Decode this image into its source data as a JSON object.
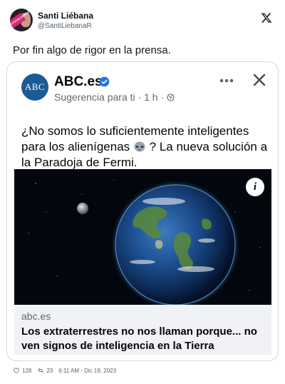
{
  "tweet": {
    "author_name": "Santi Liébana",
    "author_handle": "@SantiLiebanaR",
    "avatar_badge_text": "VISTOENLASREDES",
    "text": "Por fin algo de rigor en la prensa.",
    "likes": "128",
    "retweets": "23",
    "timestamp": "6:11 AM - Dic 19, 2023"
  },
  "embed": {
    "logo_text": "ABC",
    "source_name": "ABC.es",
    "suggestion": "Sugerencia para ti · 1 h ·",
    "headline_before_icon": "¿No somos lo suficientemente inteligentes para los alienígenas",
    "headline_after_icon": "? La nueva solución a la Paradoja de Fermi.",
    "link_domain": "abc.es",
    "link_title": "Los extraterrestres no nos llaman porque... no ven signos de inteligencia en la Tierra",
    "info_label": "i"
  },
  "colors": {
    "abc_blue": "#1c5a95",
    "verified_blue": "#1877f2",
    "link_bg": "#f0f2f5",
    "secondary_text": "#65676b"
  },
  "icons": [
    "x-logo-icon",
    "verified-badge-icon",
    "globe-icon",
    "more-options-icon",
    "close-icon",
    "alien-emoji-icon",
    "info-icon",
    "like-heart-icon",
    "retweet-icon"
  ]
}
